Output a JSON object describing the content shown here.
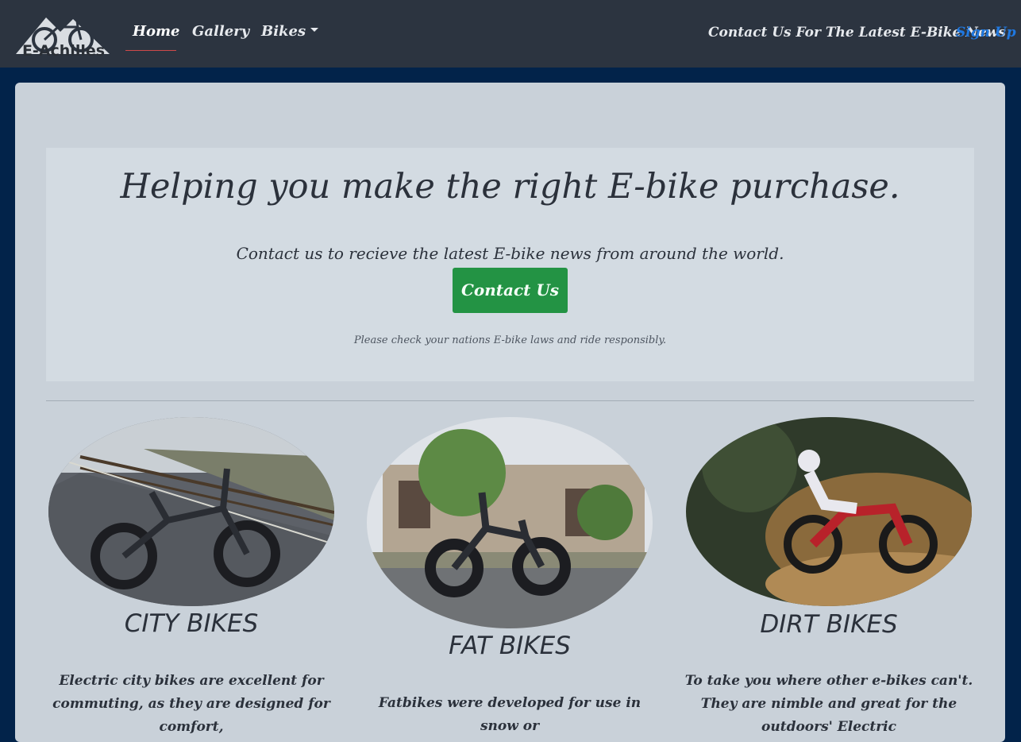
{
  "brand": {
    "name": "E-Achilles",
    "logo_icon": "bicycle-mountain-logo"
  },
  "nav": {
    "home": "Home",
    "gallery": "Gallery",
    "bikes": "Bikes",
    "contact": "Contact Us For The Latest E-Bike News",
    "signup": "Sign Up"
  },
  "hero": {
    "headline": "Helping you make the right E-bike purchase.",
    "lead": "Contact us to recieve the latest E-bike news from around the world.",
    "button": "Contact Us",
    "note": "Please check your nations E-bike laws and ride responsibly."
  },
  "bikes": [
    {
      "title": "CITY BIKES",
      "description": "Electric city bikes are excellent for commuting, as they are designed for comfort,",
      "image": "folding-city-ebike-photo"
    },
    {
      "title": "FAT BIKES",
      "description": "Fatbikes were developed for use in snow or",
      "image": "fat-tire-ebike-photo"
    },
    {
      "title": "DIRT BIKES",
      "description": "To take you where other e-bikes can't. They are nimble and great for the outdoors' Electric",
      "image": "dirt-bike-rider-photo"
    }
  ],
  "colors": {
    "navbar": "#2c3440",
    "page_background": "#02234a",
    "card": "#c9d1d9",
    "jumbotron": "#d3dbe2",
    "button": "#239344",
    "signup_link": "#1f78e0",
    "active_underline": "#d04a4a"
  }
}
